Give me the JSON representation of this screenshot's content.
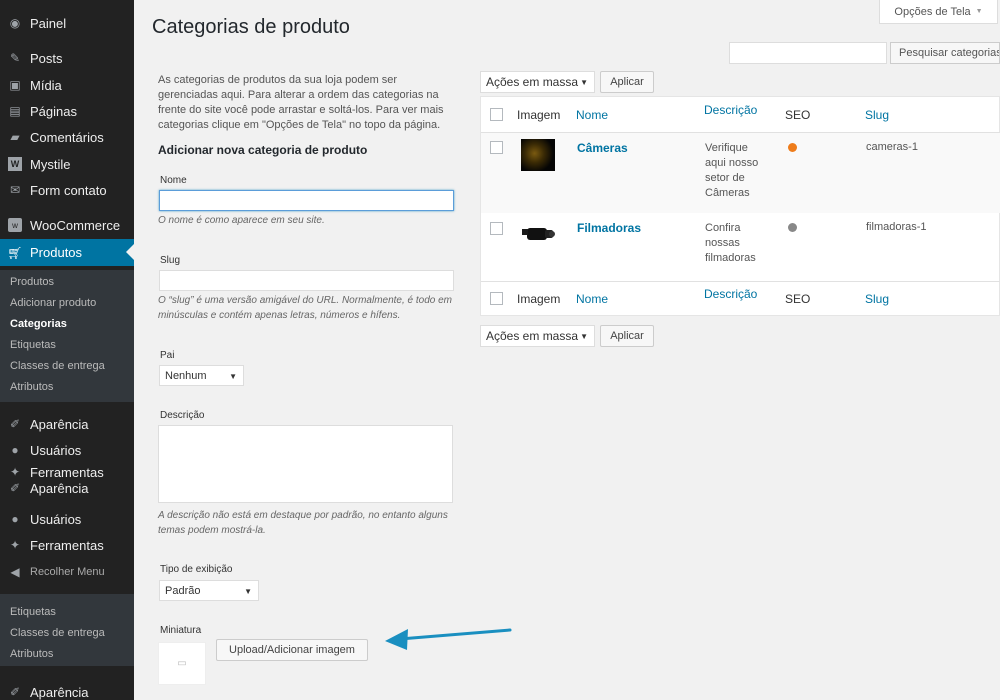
{
  "sidebar": {
    "menu": [
      {
        "label": "Painel",
        "icon": "dashboard-icon"
      },
      {
        "label": "Posts",
        "icon": "pin-icon"
      },
      {
        "label": "Mídia",
        "icon": "media-icon"
      },
      {
        "label": "Páginas",
        "icon": "pages-icon"
      },
      {
        "label": "Comentários",
        "icon": "comments-icon"
      },
      {
        "label": "Mystile",
        "icon": "theme-w-icon"
      },
      {
        "label": "Form contato",
        "icon": "mail-icon"
      },
      {
        "label": "WooCommerce",
        "icon": "woo-icon"
      },
      {
        "label": "Produtos",
        "icon": "cart-icon"
      }
    ],
    "submenu": [
      "Produtos",
      "Adicionar produto",
      "Categorias",
      "Etiquetas",
      "Classes de entrega",
      "Atributos"
    ],
    "menu2": [
      {
        "label": "Aparência",
        "icon": "brush-icon"
      },
      {
        "label": "Usuários",
        "icon": "user-icon"
      },
      {
        "label": "Ferramentas",
        "icon": "wrench-icon"
      },
      {
        "label": "Aparência",
        "icon": "brush-icon"
      },
      {
        "label": "Usuários",
        "icon": "user-icon"
      },
      {
        "label": "Ferramentas",
        "icon": "wrench-icon"
      },
      {
        "label": "Recolher Menu",
        "icon": "collapse-icon"
      }
    ],
    "submenu2": [
      "Etiquetas",
      "Classes de entrega",
      "Atributos"
    ],
    "bottom": {
      "label": "Aparência",
      "icon": "brush-icon"
    }
  },
  "header": {
    "title": "Categorias de produto",
    "screen_options": "Opções de Tela",
    "search_button": "Pesquisar categorias"
  },
  "form": {
    "intro": "As categorias de produtos da sua loja podem ser gerenciadas aqui. Para alterar a ordem das categorias na frente do site você pode arrastar e soltá-los. Para ver mais categorias clique em \"Opções de Tela\" no topo da página.",
    "heading": "Adicionar nova categoria de produto",
    "name_label": "Nome",
    "name_help": "O nome é como aparece em seu site.",
    "slug_label": "Slug",
    "slug_help": "O “slug” é uma versão amigável do URL. Normalmente, é todo em minúsculas e contém apenas letras, números e hífens.",
    "parent_label": "Pai",
    "parent_value": "Nenhum",
    "desc_label": "Descrição",
    "desc_help": "A descrição não está em destaque por padrão, no entanto alguns temas podem mostrá-la.",
    "display_label": "Tipo de exibição",
    "display_value": "Padrão",
    "thumb_label": "Miniatura",
    "upload_button": "Upload/Adicionar imagem"
  },
  "table": {
    "bulk_actions": "Ações em massa",
    "apply": "Aplicar",
    "columns": {
      "image": "Imagem",
      "name": "Nome",
      "description": "Descrição",
      "seo": "SEO",
      "slug": "Slug"
    },
    "rows": [
      {
        "name": "Câmeras",
        "description": "Verifique aqui nosso setor de Câmeras",
        "seo_color": "#ee7c1b",
        "slug": "cameras-1"
      },
      {
        "name": "Filmadoras",
        "description": "Confira nossas filmadoras",
        "seo_color": "#888888",
        "slug": "filmadoras-1"
      }
    ]
  },
  "colors": {
    "accent": "#0074a2",
    "arrow": "#1a8fc0"
  }
}
